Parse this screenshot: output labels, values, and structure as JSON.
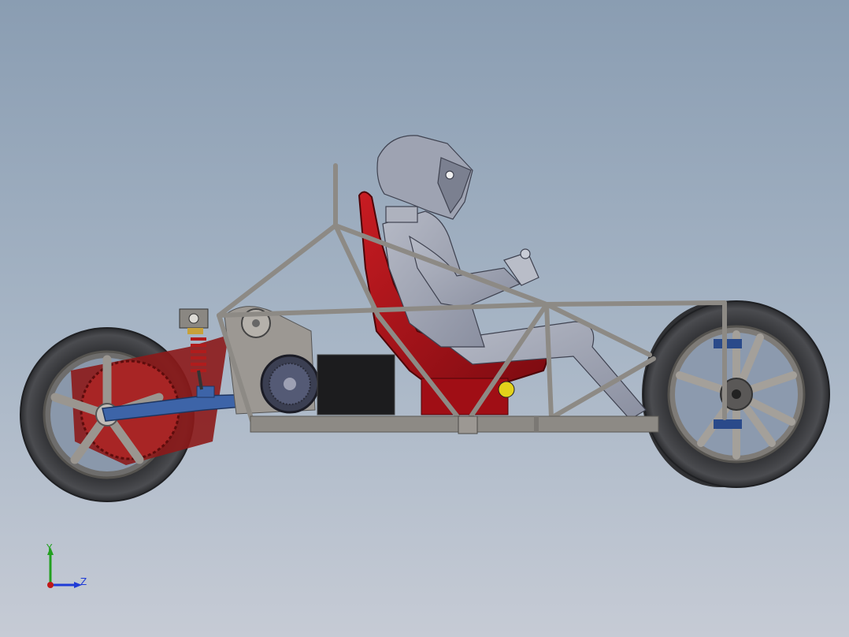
{
  "viewport": {
    "background_top": "#8a9db2",
    "background_bottom": "#c6cbd5"
  },
  "triad": {
    "y_label": "Y",
    "z_label": "Z",
    "y_color": "#23a020",
    "z_color": "#1f3bd6",
    "origin_color": "#c01818"
  },
  "colors": {
    "frame_tube": "#8d8a85",
    "tire": "#3a3b3e",
    "rim": "#8e8a86",
    "seat": "#a30f16",
    "driver": "#9ea3b2",
    "swingarm": "#3d64a8",
    "battery": "#1c1c1e",
    "fairing": "#8c1a1a",
    "spring": "#b01c1c"
  }
}
